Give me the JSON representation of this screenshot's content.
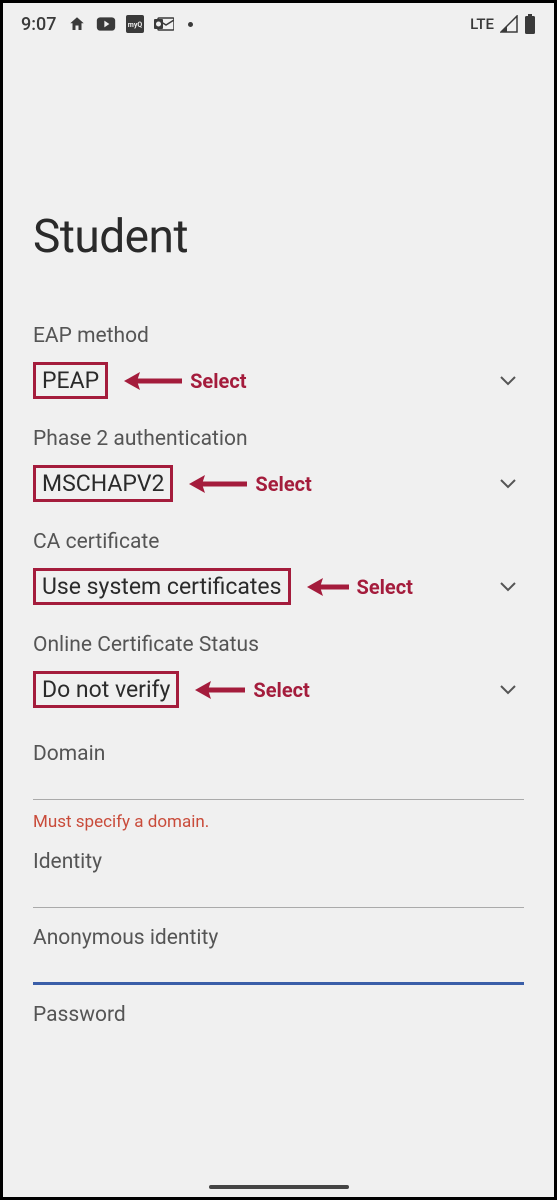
{
  "status": {
    "time": "9:07",
    "network": "LTE"
  },
  "page": {
    "title": "Student"
  },
  "fields": {
    "eap": {
      "label": "EAP method",
      "value": "PEAP",
      "annotation": "Select"
    },
    "phase2": {
      "label": "Phase 2 authentication",
      "value": "MSCHAPV2",
      "annotation": "Select"
    },
    "ca": {
      "label": "CA certificate",
      "value": "Use system certificates",
      "annotation": "Select"
    },
    "ocs": {
      "label": "Online Certificate Status",
      "value": "Do not verify",
      "annotation": "Select"
    },
    "domain": {
      "label": "Domain",
      "error": "Must specify a domain."
    },
    "identity": {
      "label": "Identity"
    },
    "anon": {
      "label": "Anonymous identity"
    },
    "password": {
      "label": "Password"
    }
  }
}
